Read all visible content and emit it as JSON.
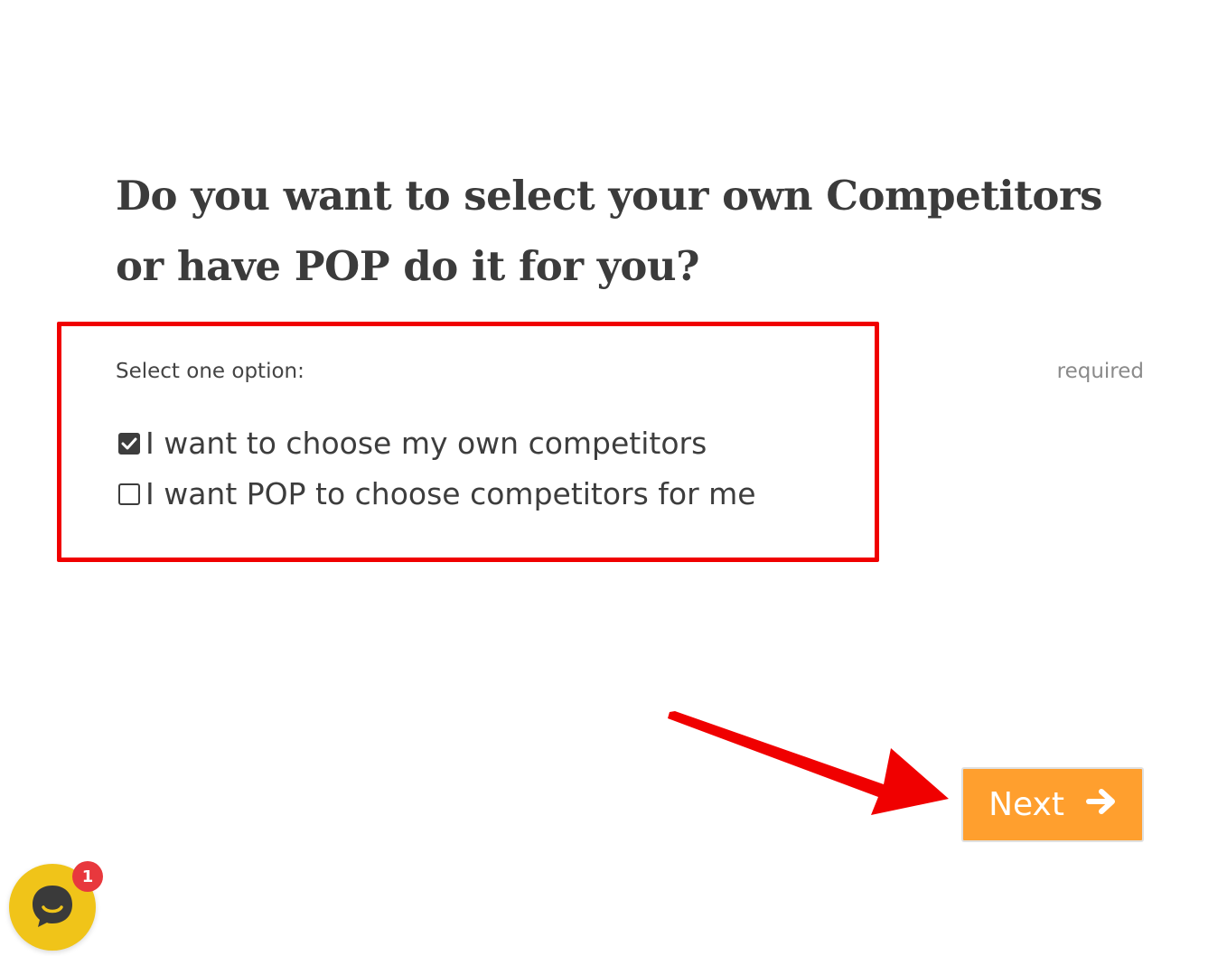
{
  "question": {
    "title": "Do you want to select your own Competitors or have POP do it for you?"
  },
  "form": {
    "select_label": "Select one option:",
    "required_label": "required",
    "options": [
      {
        "label": "I want to choose my own competitors",
        "checked": true
      },
      {
        "label": "I want POP to choose competitors for me",
        "checked": false
      }
    ]
  },
  "actions": {
    "next_label": "Next",
    "next_icon": "arrow-right-icon"
  },
  "chat": {
    "icon": "chat-bubble-icon",
    "badge_count": "1"
  },
  "colors": {
    "accent_orange": "#ff9f2e",
    "annotation_red": "#f00000",
    "chat_yellow": "#f0c419",
    "badge_red": "#e8383d",
    "text_dark": "#3b3b3b"
  }
}
